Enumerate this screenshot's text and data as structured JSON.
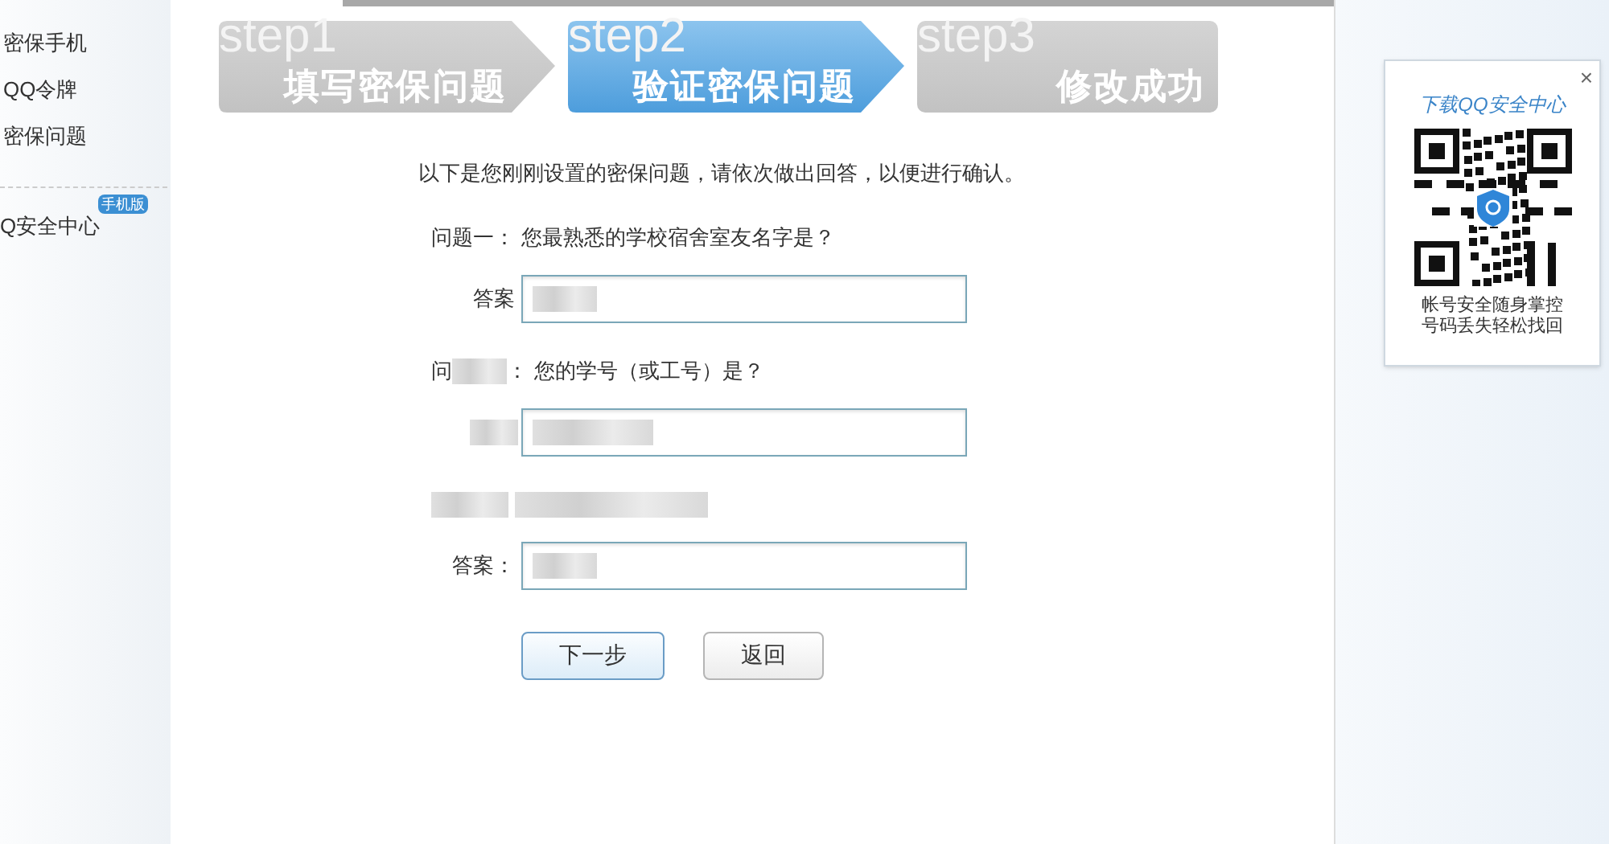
{
  "sidebar": {
    "items": [
      {
        "label": "密保手机"
      },
      {
        "label": "QQ令牌"
      },
      {
        "label": "密保问题"
      }
    ],
    "app_link": {
      "label": "Q安全中心",
      "badge": "手机版"
    }
  },
  "steps": [
    {
      "step": "step1",
      "title": "填写密保问题",
      "selected": false
    },
    {
      "step": "step2",
      "title": "验证密保问题",
      "selected": true
    },
    {
      "step": "step3",
      "title": "修改成功",
      "selected": false
    }
  ],
  "intro": "以下是您刚刚设置的密保问题，请依次做出回答，以便进行确认。",
  "questions": [
    {
      "label": "问题一：",
      "label_redacted": false,
      "text": "您最熟悉的学校宿舍室友名字是？",
      "text_redacted": false,
      "answer_label": "答案",
      "answer_redacted": true
    },
    {
      "label": "问",
      "label_redacted": true,
      "label_end": "：",
      "text": "您的学号（或工号）是？",
      "text_redacted": false,
      "answer_redacted": true
    },
    {
      "label_redacted": true,
      "text_redacted": true,
      "answer_label": "答案：",
      "answer_redacted": true
    }
  ],
  "buttons": [
    {
      "label": "下一步",
      "kind": "primary"
    },
    {
      "label": "返回",
      "kind": "secondary"
    }
  ],
  "promo": {
    "close": "×",
    "title": "下载QQ安全中心",
    "caption": [
      "帐号安全随身掌控",
      "号码丢失轻松找回"
    ]
  }
}
